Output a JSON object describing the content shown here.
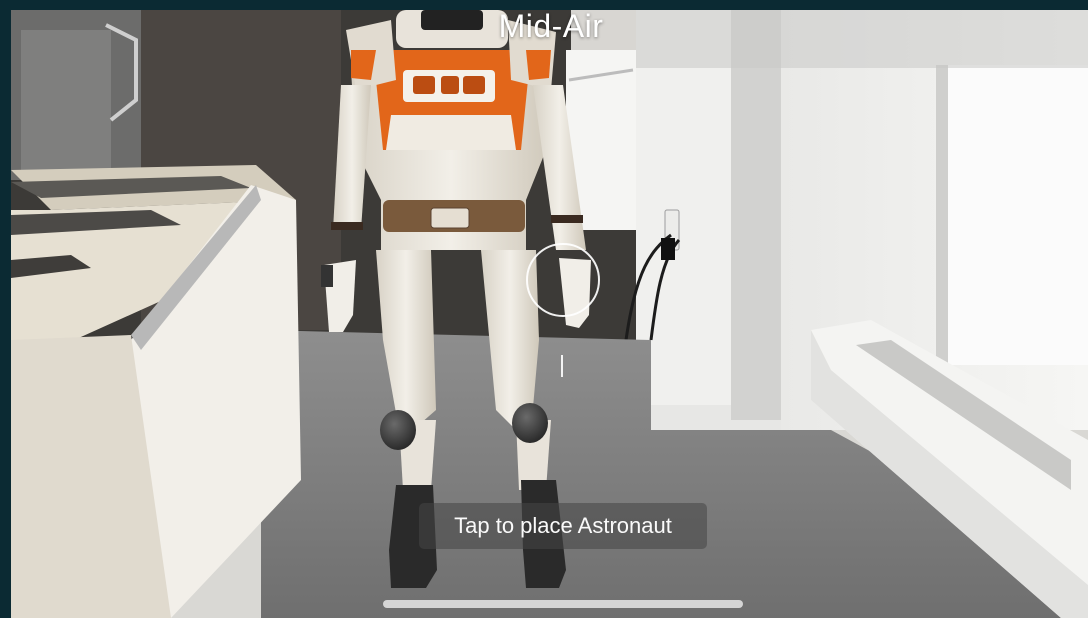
{
  "header": {
    "mode_title": "Mid-Air"
  },
  "placement": {
    "hint_text": "Tap to place Astronaut"
  },
  "colors": {
    "hint_background": "#464646",
    "reticle": "#ffffff",
    "suit_accent": "#e2661a"
  },
  "icons": {
    "reticle": "placement-reticle-icon"
  }
}
